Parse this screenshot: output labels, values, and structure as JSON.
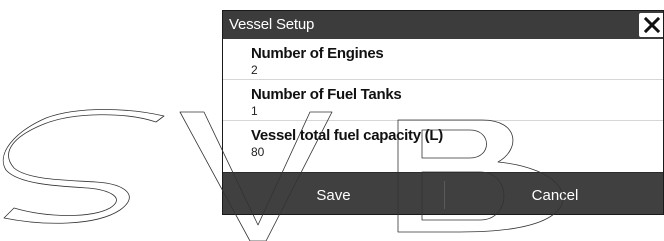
{
  "dialog": {
    "title": "Vessel Setup",
    "close_icon": "close-x-icon",
    "settings": [
      {
        "label": "Number of Engines",
        "value": "2"
      },
      {
        "label": "Number of Fuel Tanks",
        "value": "1"
      },
      {
        "label": "Vessel total fuel capacity (L)",
        "value": "80"
      }
    ],
    "buttons": {
      "save": "Save",
      "cancel": "Cancel"
    }
  },
  "colors": {
    "titlebar": "#3c3c3c",
    "buttonbar": "#404040",
    "watermark": "#333333"
  },
  "watermark": {
    "text": "SVB"
  }
}
